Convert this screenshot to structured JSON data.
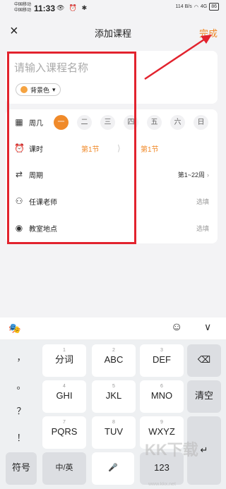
{
  "status_bar": {
    "carrier_1": "中国移动",
    "carrier_2": "中国移动",
    "time": "11:33",
    "icons": "👁 ⏰ ✱",
    "net_speed": "114 B/s",
    "network": "4G",
    "battery": "86"
  },
  "header": {
    "close_icon": "×",
    "title": "添加课程",
    "done_label": "完成"
  },
  "name_card": {
    "placeholder": "请输入课程名称",
    "bg_color_label": "背景色",
    "bg_color": "#f5a341"
  },
  "detail": {
    "weekday": {
      "label": "周几",
      "days": [
        "一",
        "二",
        "三",
        "四",
        "五",
        "六",
        "日"
      ],
      "selected_index": 0
    },
    "lesson": {
      "label": "课时",
      "from": "第1节",
      "to": "第1节"
    },
    "weeks": {
      "label": "周期",
      "value": "第1~22周"
    },
    "teacher": {
      "label": "任课老师",
      "hint": "选填"
    },
    "location": {
      "label": "教室地点",
      "hint": "选填"
    }
  },
  "keyboard": {
    "punctuation": [
      "，",
      "。",
      "？",
      "！"
    ],
    "keys": [
      {
        "num": "1",
        "txt": "分词"
      },
      {
        "num": "2",
        "txt": "ABC"
      },
      {
        "num": "3",
        "txt": "DEF"
      },
      {
        "num": "4",
        "txt": "GHI"
      },
      {
        "num": "5",
        "txt": "JKL"
      },
      {
        "num": "6",
        "txt": "MNO"
      },
      {
        "num": "7",
        "txt": "PQRS"
      },
      {
        "num": "8",
        "txt": "TUV"
      },
      {
        "num": "9",
        "txt": "WXYZ"
      }
    ],
    "delete_icon": "⌫",
    "clear_label": "清空",
    "symbol_label": "符号",
    "lang_label": "中/英",
    "mic_icon": "🎤",
    "numeric_label": "123",
    "toolbar": {
      "logo_icon": "🎭",
      "emoji_icon": "☺",
      "collapse_icon": "∨"
    }
  },
  "watermark": {
    "text": "KK下载",
    "url": "www.kkx.net"
  },
  "colors": {
    "accent": "#f08a2a",
    "annotation_red": "#e2232e"
  }
}
